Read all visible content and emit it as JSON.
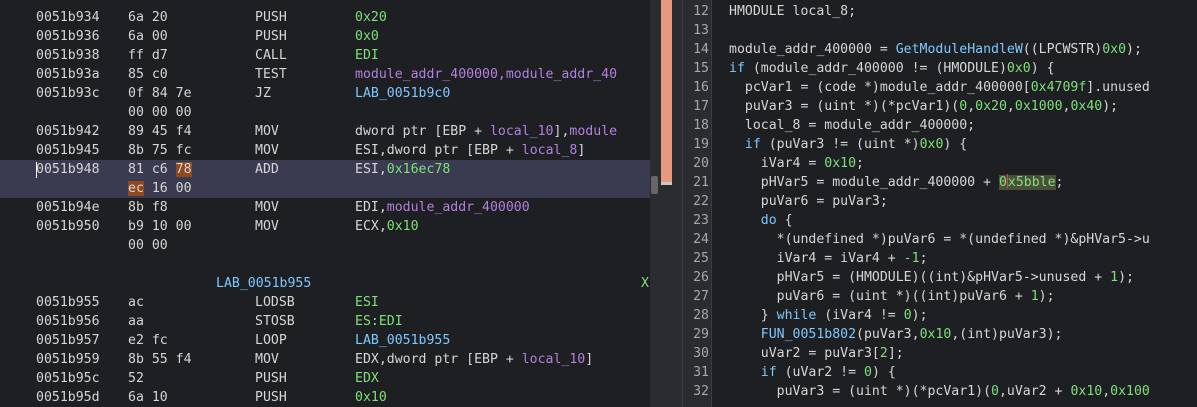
{
  "listing": {
    "rows": [
      {
        "addr": "0051b934",
        "bytes": "6a 20",
        "mnem": "PUSH",
        "ops": [
          {
            "t": "0x20",
            "c": "num"
          }
        ]
      },
      {
        "addr": "0051b936",
        "bytes": "6a 00",
        "mnem": "PUSH",
        "ops": [
          {
            "t": "0x0",
            "c": "num"
          }
        ]
      },
      {
        "addr": "0051b938",
        "bytes": "ff d7",
        "mnem": "CALL",
        "ops": [
          {
            "t": "EDI",
            "c": "num"
          }
        ]
      },
      {
        "addr": "0051b93a",
        "bytes": "85 c0",
        "mnem": "TEST",
        "ops": [
          {
            "t": "module_addr_400000,module_addr_40",
            "c": "sym"
          }
        ]
      },
      {
        "addr": "0051b93c",
        "bytes": "0f 84 7e",
        "mnem": "JZ",
        "ops": [
          {
            "t": "LAB_0051b9c0",
            "c": "lbl"
          }
        ]
      },
      {
        "addr": "",
        "bytes": "00 00 00",
        "mnem": "",
        "ops": []
      },
      {
        "addr": "0051b942",
        "bytes": "89 45 f4",
        "mnem": "MOV",
        "ops": [
          {
            "t": "dword ptr [EBP + ",
            "c": ""
          },
          {
            "t": "local_10",
            "c": "sym"
          },
          {
            "t": "],",
            "c": ""
          },
          {
            "t": "module",
            "c": "sym"
          }
        ]
      },
      {
        "addr": "0051b945",
        "bytes": "8b 75 fc",
        "mnem": "MOV",
        "ops": [
          {
            "t": "ESI",
            "c": ""
          },
          {
            "t": ",dword ptr [EBP + ",
            "c": ""
          },
          {
            "t": "local_8",
            "c": "sym"
          },
          {
            "t": "]",
            "c": ""
          }
        ]
      },
      {
        "addr": "0051b948",
        "bytes": "81 c6 78",
        "mnem": "ADD",
        "ops": [
          {
            "t": "ESI,",
            "c": ""
          },
          {
            "t": "0x16ec78",
            "c": "num"
          }
        ],
        "current": true
      },
      {
        "addr": "",
        "bytes": "ec 16 00",
        "mnem": "",
        "ops": [],
        "current": true
      },
      {
        "addr": "0051b94e",
        "bytes": "8b f8",
        "mnem": "MOV",
        "ops": [
          {
            "t": "EDI,",
            "c": ""
          },
          {
            "t": "module_addr_400000",
            "c": "sym"
          }
        ]
      },
      {
        "addr": "0051b950",
        "bytes": "b9 10 00",
        "mnem": "MOV",
        "ops": [
          {
            "t": "ECX,",
            "c": ""
          },
          {
            "t": "0x10",
            "c": "num"
          }
        ]
      },
      {
        "addr": "",
        "bytes": "00 00",
        "mnem": "",
        "ops": []
      },
      {
        "addr": "",
        "bytes": "",
        "mnem": "",
        "ops": []
      },
      {
        "label": "LAB_0051b955",
        "xref": "X"
      },
      {
        "addr": "0051b955",
        "bytes": "ac",
        "mnem": "LODSB",
        "ops": [
          {
            "t": "ESI",
            "c": "num"
          }
        ]
      },
      {
        "addr": "0051b956",
        "bytes": "aa",
        "mnem": "STOSB",
        "ops": [
          {
            "t": "ES:EDI",
            "c": "num"
          }
        ]
      },
      {
        "addr": "0051b957",
        "bytes": "e2 fc",
        "mnem": "LOOP",
        "ops": [
          {
            "t": "LAB_0051b955",
            "c": "lbl"
          }
        ]
      },
      {
        "addr": "0051b959",
        "bytes": "8b 55 f4",
        "mnem": "MOV",
        "ops": [
          {
            "t": "EDX,dword ptr [EBP + ",
            "c": ""
          },
          {
            "t": "local_10",
            "c": "sym"
          },
          {
            "t": "]",
            "c": ""
          }
        ]
      },
      {
        "addr": "0051b95c",
        "bytes": "52",
        "mnem": "PUSH",
        "ops": [
          {
            "t": "EDX",
            "c": "num"
          }
        ]
      },
      {
        "addr": "0051b95d",
        "bytes": "6a 10",
        "mnem": "PUSH",
        "ops": [
          {
            "t": "0x10",
            "c": "num"
          }
        ]
      }
    ]
  },
  "decompiler": {
    "lines": [
      {
        "n": "12",
        "parts": [
          {
            "t": "HMODULE local_8;",
            "c": ""
          }
        ]
      },
      {
        "n": "13",
        "parts": []
      },
      {
        "n": "14",
        "parts": [
          {
            "t": "module_addr_400000 = ",
            "c": ""
          },
          {
            "t": "GetModuleHandleW",
            "c": "fn"
          },
          {
            "t": "((LPCWSTR)",
            "c": ""
          },
          {
            "t": "0x0",
            "c": "dnum"
          },
          {
            "t": ");",
            "c": ""
          }
        ]
      },
      {
        "n": "15",
        "parts": [
          {
            "t": "if",
            "c": "kw"
          },
          {
            "t": " (module_addr_400000 != (HMODULE)",
            "c": ""
          },
          {
            "t": "0x0",
            "c": "dnum"
          },
          {
            "t": ") {",
            "c": ""
          }
        ]
      },
      {
        "n": "16",
        "parts": [
          {
            "t": "  pcVar1 = (code *)module_addr_400000[",
            "c": ""
          },
          {
            "t": "0x4709f",
            "c": "dnum"
          },
          {
            "t": "].unused",
            "c": ""
          }
        ]
      },
      {
        "n": "17",
        "parts": [
          {
            "t": "  puVar3 = (uint *)(*pcVar1)(",
            "c": ""
          },
          {
            "t": "0",
            "c": "dnum"
          },
          {
            "t": ",",
            "c": ""
          },
          {
            "t": "0x20",
            "c": "dnum"
          },
          {
            "t": ",",
            "c": ""
          },
          {
            "t": "0x1000",
            "c": "dnum"
          },
          {
            "t": ",",
            "c": ""
          },
          {
            "t": "0x40",
            "c": "dnum"
          },
          {
            "t": ");",
            "c": ""
          }
        ]
      },
      {
        "n": "18",
        "parts": [
          {
            "t": "  local_8 = module_addr_400000;",
            "c": ""
          }
        ]
      },
      {
        "n": "19",
        "parts": [
          {
            "t": "  ",
            "c": ""
          },
          {
            "t": "if",
            "c": "kw"
          },
          {
            "t": " (puVar3 != (uint *)",
            "c": ""
          },
          {
            "t": "0x0",
            "c": "dnum"
          },
          {
            "t": ") {",
            "c": ""
          }
        ]
      },
      {
        "n": "20",
        "parts": [
          {
            "t": "    iVar4 = ",
            "c": ""
          },
          {
            "t": "0x10",
            "c": "dnum"
          },
          {
            "t": ";",
            "c": ""
          }
        ]
      },
      {
        "n": "21",
        "parts": [
          {
            "t": "    pHVar5 = module_addr_400000 + ",
            "c": ""
          },
          {
            "t": "0x5bble",
            "c": "cur"
          },
          {
            "t": ";",
            "c": ""
          }
        ]
      },
      {
        "n": "22",
        "parts": [
          {
            "t": "    puVar6 = puVar3;",
            "c": ""
          }
        ]
      },
      {
        "n": "23",
        "parts": [
          {
            "t": "    ",
            "c": ""
          },
          {
            "t": "do",
            "c": "kw"
          },
          {
            "t": " {",
            "c": ""
          }
        ]
      },
      {
        "n": "24",
        "parts": [
          {
            "t": "      *(undefined *)puVar6 = *(undefined *)&pHVar5->u",
            "c": ""
          }
        ]
      },
      {
        "n": "25",
        "parts": [
          {
            "t": "      iVar4 = iVar4 + ",
            "c": ""
          },
          {
            "t": "-1",
            "c": "dnum"
          },
          {
            "t": ";",
            "c": ""
          }
        ]
      },
      {
        "n": "26",
        "parts": [
          {
            "t": "      pHVar5 = (HMODULE)((int)&pHVar5->unused + ",
            "c": ""
          },
          {
            "t": "1",
            "c": "dnum"
          },
          {
            "t": ");",
            "c": ""
          }
        ]
      },
      {
        "n": "27",
        "parts": [
          {
            "t": "      puVar6 = (uint *)((int)puVar6 + ",
            "c": ""
          },
          {
            "t": "1",
            "c": "dnum"
          },
          {
            "t": ");",
            "c": ""
          }
        ]
      },
      {
        "n": "28",
        "parts": [
          {
            "t": "    } ",
            "c": ""
          },
          {
            "t": "while",
            "c": "kw"
          },
          {
            "t": " (iVar4 != ",
            "c": ""
          },
          {
            "t": "0",
            "c": "dnum"
          },
          {
            "t": ");",
            "c": ""
          }
        ]
      },
      {
        "n": "29",
        "parts": [
          {
            "t": "    ",
            "c": ""
          },
          {
            "t": "FUN_0051b802",
            "c": "fn"
          },
          {
            "t": "(puVar3,",
            "c": ""
          },
          {
            "t": "0x10",
            "c": "dnum"
          },
          {
            "t": ",(int)puVar3);",
            "c": ""
          }
        ]
      },
      {
        "n": "30",
        "parts": [
          {
            "t": "    uVar2 = puVar3[",
            "c": ""
          },
          {
            "t": "2",
            "c": "dnum"
          },
          {
            "t": "];",
            "c": ""
          }
        ]
      },
      {
        "n": "31",
        "parts": [
          {
            "t": "    ",
            "c": ""
          },
          {
            "t": "if",
            "c": "kw"
          },
          {
            "t": " (uVar2 != ",
            "c": ""
          },
          {
            "t": "0",
            "c": "dnum"
          },
          {
            "t": ") {",
            "c": ""
          }
        ]
      },
      {
        "n": "32",
        "parts": [
          {
            "t": "      puVar3 = (uint *)(*pcVar1)(",
            "c": ""
          },
          {
            "t": "0",
            "c": "dnum"
          },
          {
            "t": ",uVar2 + ",
            "c": ""
          },
          {
            "t": "0x10",
            "c": "dnum"
          },
          {
            "t": ",",
            "c": ""
          },
          {
            "t": "0x100",
            "c": "dnum"
          }
        ]
      }
    ]
  },
  "colors": {
    "background": "#1e1f22",
    "current_line": "#3a3b50",
    "number": "#7ee07a",
    "symbol": "#b47fe0",
    "label": "#7ec8ff",
    "overview_marker": "#e59a7d"
  }
}
